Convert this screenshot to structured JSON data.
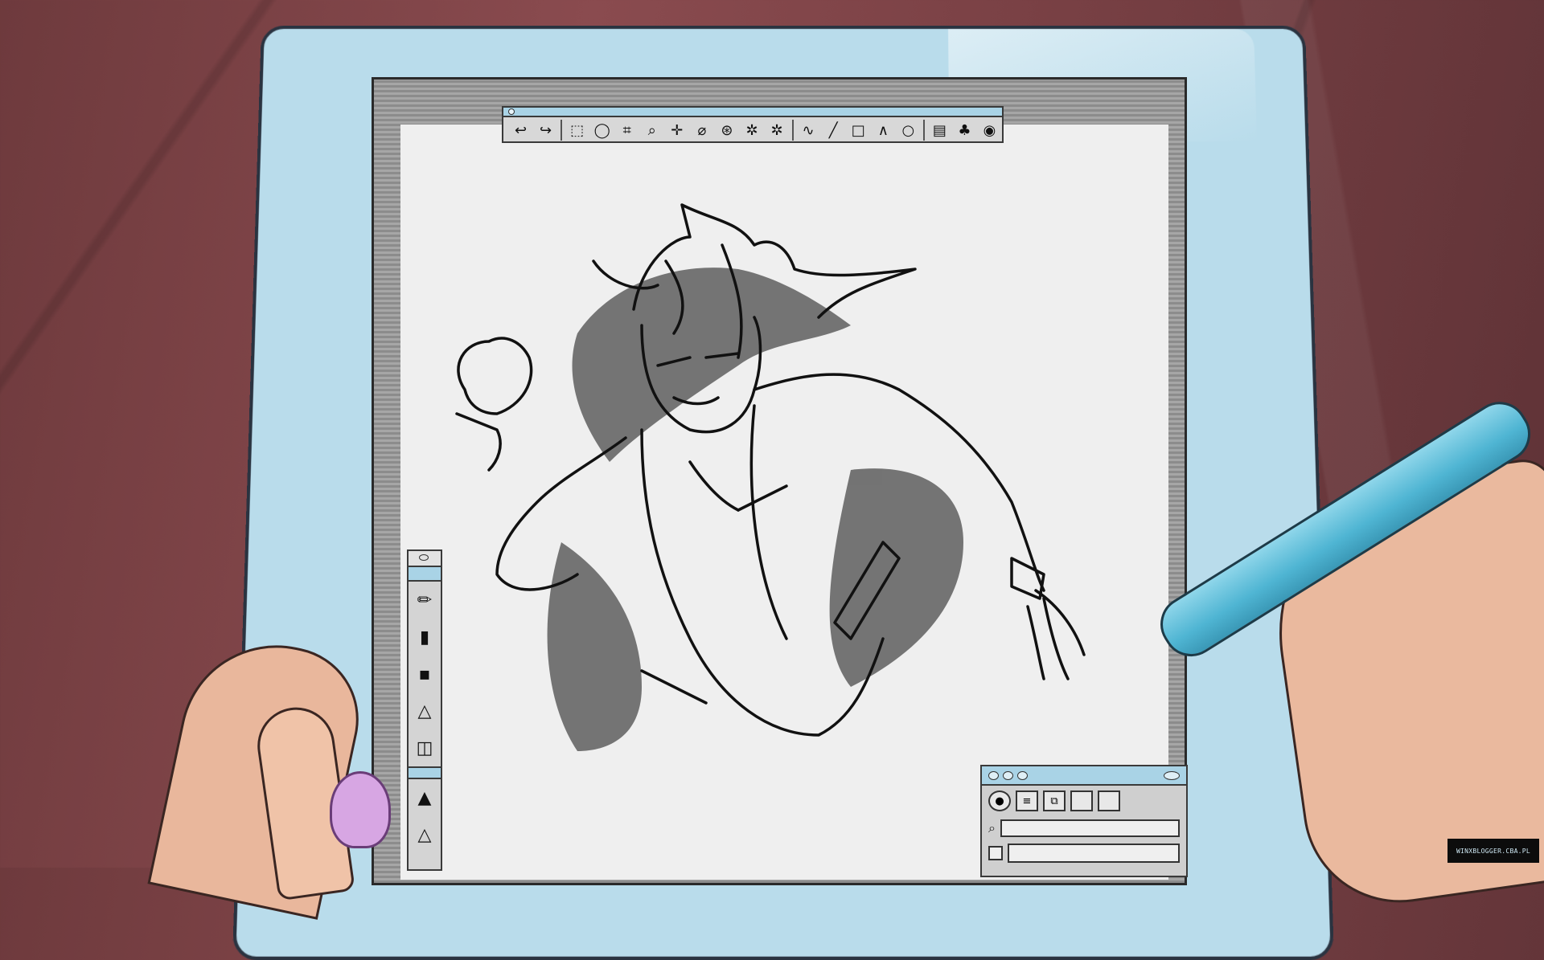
{
  "watermark": "WINXBLOGGER.CBA.PL",
  "toolbar": {
    "tools": [
      {
        "name": "undo-icon",
        "glyph": "↩"
      },
      {
        "name": "redo-icon",
        "glyph": "↪"
      },
      {
        "name": "sep"
      },
      {
        "name": "rect-select-icon",
        "glyph": "⬚"
      },
      {
        "name": "lasso-icon",
        "glyph": "◯"
      },
      {
        "name": "crop-icon",
        "glyph": "⌗"
      },
      {
        "name": "zoom-icon",
        "glyph": "⌕"
      },
      {
        "name": "move-icon",
        "glyph": "✛"
      },
      {
        "name": "eraser-icon",
        "glyph": "⌀"
      },
      {
        "name": "fill-icon",
        "glyph": "⊛"
      },
      {
        "name": "magic-wand-icon",
        "glyph": "✲"
      },
      {
        "name": "magic-wand-alt-icon",
        "glyph": "✲"
      },
      {
        "name": "sep"
      },
      {
        "name": "curve-icon",
        "glyph": "∿"
      },
      {
        "name": "line-icon",
        "glyph": "╱"
      },
      {
        "name": "rectangle-icon",
        "glyph": "□"
      },
      {
        "name": "polyline-icon",
        "glyph": "∧"
      },
      {
        "name": "ellipse-icon",
        "glyph": "○"
      },
      {
        "name": "sep"
      },
      {
        "name": "layers-stack-icon",
        "glyph": "▤"
      },
      {
        "name": "palette-icon",
        "glyph": "♣"
      },
      {
        "name": "color-wheel-icon",
        "glyph": "◉"
      }
    ]
  },
  "brushes": [
    {
      "name": "pencil-icon",
      "glyph": "✏"
    },
    {
      "name": "marker-icon",
      "glyph": "▮"
    },
    {
      "name": "ink-brush-icon",
      "glyph": "▪"
    },
    {
      "name": "triangle-brush-icon",
      "glyph": "△"
    },
    {
      "name": "bucket-icon",
      "glyph": "◫"
    },
    {
      "name": "sep"
    },
    {
      "name": "pen-nib-icon",
      "glyph": "▲"
    },
    {
      "name": "fine-pen-icon",
      "glyph": "△"
    }
  ],
  "layers_panel": {
    "search_placeholder": ""
  },
  "colors": {
    "tablet": "#b9dceb",
    "accent": "#a9d3e6",
    "canvas": "#efefef",
    "pen": "#4fb5d3"
  }
}
